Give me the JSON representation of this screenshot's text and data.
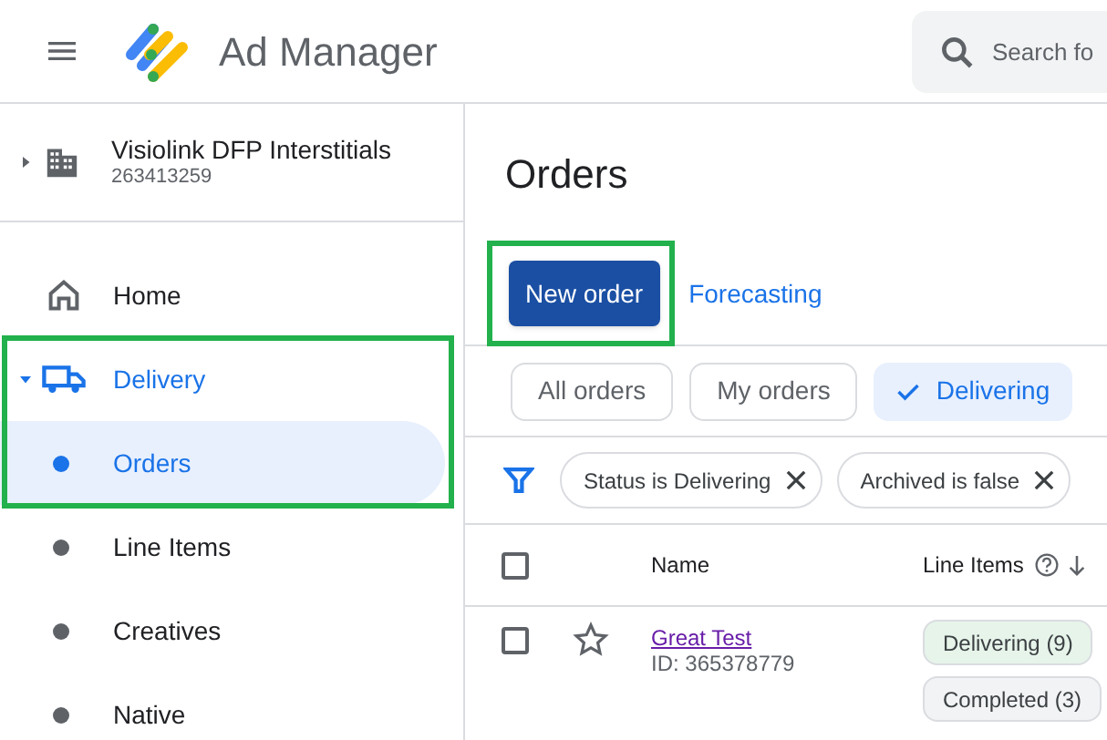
{
  "header": {
    "title": "Ad Manager",
    "search": {
      "placeholder": "Search fo"
    }
  },
  "account": {
    "name": "Visiolink DFP Interstitials",
    "id": "263413259",
    "expanded": false
  },
  "nav": [
    {
      "label": "Home",
      "selected": false
    },
    {
      "label": "Delivery",
      "selected": true,
      "expanded": true,
      "children": [
        {
          "label": "Orders",
          "selected": true
        },
        {
          "label": "Line Items",
          "selected": false
        },
        {
          "label": "Creatives",
          "selected": false
        },
        {
          "label": "Native",
          "selected": false
        }
      ]
    }
  ],
  "page": {
    "title": "Orders",
    "actions": [
      {
        "label": "New order",
        "kind": "primary"
      },
      {
        "label": "Forecasting",
        "kind": "link"
      }
    ],
    "views": [
      {
        "label": "All orders",
        "selected": false
      },
      {
        "label": "My orders",
        "selected": false
      },
      {
        "label": "Delivering",
        "selected": true
      }
    ],
    "filters": [
      {
        "label": "Status is Delivering"
      },
      {
        "label": "Archived is false"
      }
    ],
    "table": {
      "header_checked": false,
      "columns": [
        {
          "label": "Name"
        },
        {
          "label": "Line Items",
          "sorted": true
        }
      ],
      "rows": [
        {
          "checked": false,
          "starred": false,
          "name": "Great Test",
          "id": "ID: 365378779",
          "line_items": [
            {
              "label": "Delivering (9)",
              "color": "#e6f4ea"
            },
            {
              "label": "Completed (3)",
              "color": "#f1f3f4"
            }
          ]
        }
      ]
    }
  }
}
